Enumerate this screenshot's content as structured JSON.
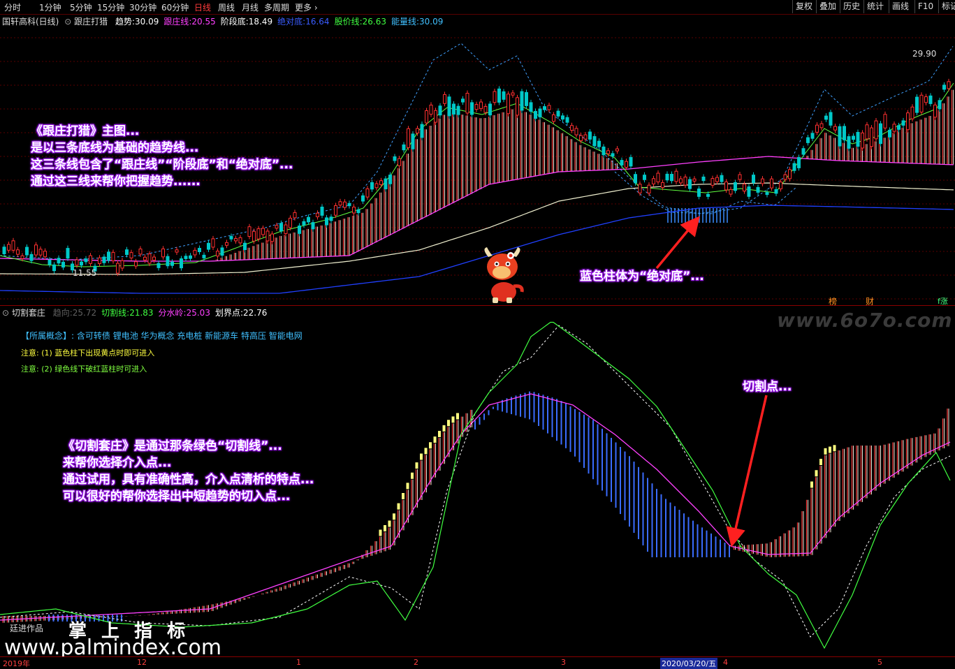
{
  "toolbar": {
    "timeframes": [
      "分时",
      "1分钟",
      "5分钟",
      "15分钟",
      "30分钟",
      "60分钟",
      "日线",
      "周线",
      "月线",
      "多周期",
      "更多"
    ],
    "active_timeframe": "日线",
    "right_buttons": [
      "复权",
      "叠加",
      "历史",
      "统计",
      "画线",
      "F10",
      "标记"
    ]
  },
  "upper": {
    "stock": "国轩高科(日线)",
    "indicator": "跟庄打猎",
    "values": [
      {
        "label": "趋势:",
        "value": "30.09",
        "color": "#ffffff"
      },
      {
        "label": "跟庄线:",
        "value": "20.55",
        "color": "#ff40ff"
      },
      {
        "label": "阶段底:",
        "value": "18.49",
        "color": "#ffffff"
      },
      {
        "label": "绝对底:",
        "value": "16.64",
        "color": "#3a5cff"
      },
      {
        "label": "股价线:",
        "value": "26.63",
        "color": "#40ff40"
      },
      {
        "label": "能量线:",
        "value": "30.09",
        "color": "#40c0ff"
      }
    ],
    "price_high": "29.90",
    "price_low": "11.55",
    "badges": [
      "榜",
      "财",
      "f涨"
    ],
    "callout_lines": [
      "《跟庄打猎》主图...",
      "是以三条底线为基础的趋势线...",
      "这三条线包含了“跟庄线”“阶段底”和“绝对底”...",
      "通过这三线来帮你把握趋势......"
    ],
    "blue_bar_note": "蓝色柱体为“绝对底”..."
  },
  "lower": {
    "indicator": "切割套庄",
    "values": [
      {
        "label": "趋向:",
        "value": "25.72",
        "color": "#606060"
      },
      {
        "label": "切割线:",
        "value": "21.83",
        "color": "#40ff40"
      },
      {
        "label": "分水岭:",
        "value": "25.03",
        "color": "#ff40ff"
      },
      {
        "label": "划界点:",
        "value": "22.76",
        "color": "#ffffff"
      }
    ],
    "concept_label": "【所属概念】:",
    "concepts": "含可转债 锂电池 华为概念 充电桩 新能源车 特高压 智能电网",
    "note1": "注意: (1) 蓝色柱下出现黄点时即可进入",
    "note2": "注意: (2) 绿色线下破红蓝柱时可进入",
    "callout_lines": [
      "《切割套庄》是通过那条绿色“切割线”...",
      "来帮你选择介入点...",
      "通过试用，具有准确性高，介入点清析的特点...",
      "可以很好的帮你选择出中短趋势的切入点..."
    ],
    "cut_point_label": "切割点...",
    "author": "廷进作品"
  },
  "watermarks": {
    "site1": "www.6o7o.com",
    "brand": "掌 上 指 标",
    "site2": "www.palmindex.com"
  },
  "timeline": {
    "labels": [
      "2019年",
      "12",
      "1",
      "2",
      "3",
      "2020/03/20/五",
      "4",
      "5"
    ],
    "selected": "2020/03/20/五"
  },
  "colors": {
    "up": "#ff3030",
    "down": "#00c8c8",
    "callout_glow": "#a020f0",
    "divider": "#8a0000"
  }
}
